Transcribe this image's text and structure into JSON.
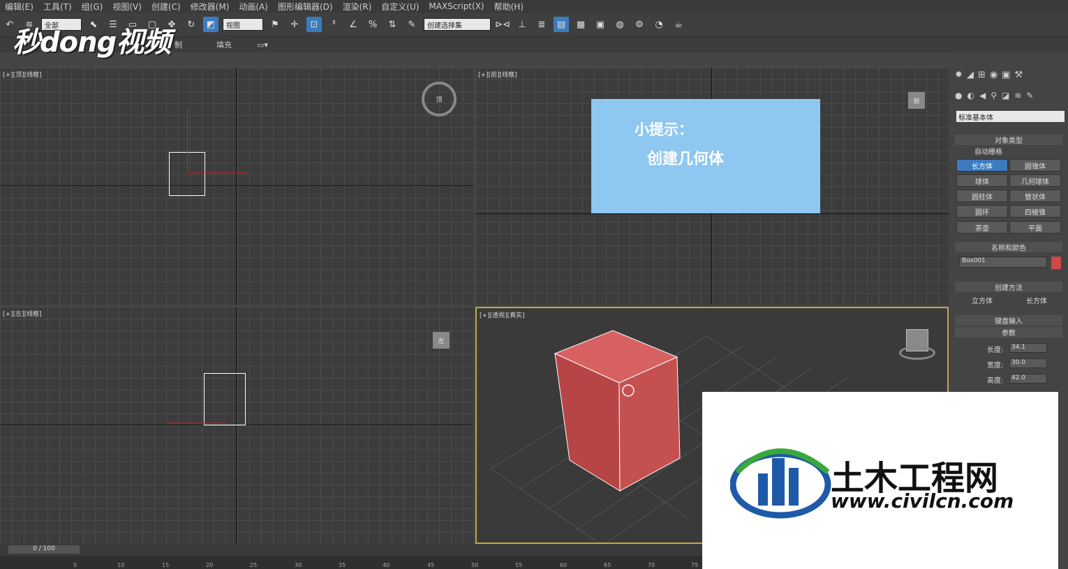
{
  "menu": [
    "编辑(E)",
    "工具(T)",
    "组(G)",
    "视图(V)",
    "创建(C)",
    "修改器(M)",
    "动画(A)",
    "图形编辑器(D)",
    "渲染(R)",
    "自定义(U)",
    "MAXScript(X)",
    "帮助(H)"
  ],
  "toolbar": {
    "selection_filter": "全部",
    "ref_coord": "视图",
    "named_selection": "创建选择集"
  },
  "ribbon": {
    "item1": "制",
    "item2": "填充"
  },
  "watermark": {
    "brand": "秒dong视频"
  },
  "viewports": {
    "top": {
      "label": "[+][顶][线框]",
      "cube": "顶"
    },
    "front": {
      "label": "[+][前][线框]",
      "cube": "前"
    },
    "left": {
      "label": "[+][左][线框]",
      "cube": "左"
    },
    "persp": {
      "label": "[+][透视][真实]"
    }
  },
  "tip": {
    "title": "小提示：",
    "body": "创建几何体"
  },
  "cmd": {
    "category": "标准基本体",
    "object_type": "对象类型",
    "auto_grid": "自动栅格",
    "buttons": [
      "长方体",
      "圆锥体",
      "球体",
      "几何球体",
      "圆柱体",
      "管状体",
      "圆环",
      "四棱锥",
      "茶壶",
      "平面"
    ],
    "name_color": "名称和颜色",
    "object_name": "Box001",
    "object_color": "#d04848",
    "creation_method": "创建方法",
    "cube_opt": "立方体",
    "box_opt": "长方体",
    "keyboard_entry": "键盘输入",
    "params": "参数",
    "length_label": "长度:",
    "length": "34.1",
    "width_label": "宽度:",
    "width": "30.0",
    "height_label": "高度:",
    "height": "42.0"
  },
  "timeline": {
    "frame": "0 / 100",
    "ticks": [
      "5",
      "10",
      "15",
      "20",
      "25",
      "30",
      "35",
      "40",
      "45",
      "50",
      "55",
      "60",
      "65",
      "70",
      "75"
    ]
  },
  "logo": {
    "title": "土木工程网",
    "url": "www.civilcn.com"
  },
  "colors": {
    "accent": "#3d7bbf",
    "tip_bg": "#8ec7f0",
    "box": "#c85050"
  }
}
